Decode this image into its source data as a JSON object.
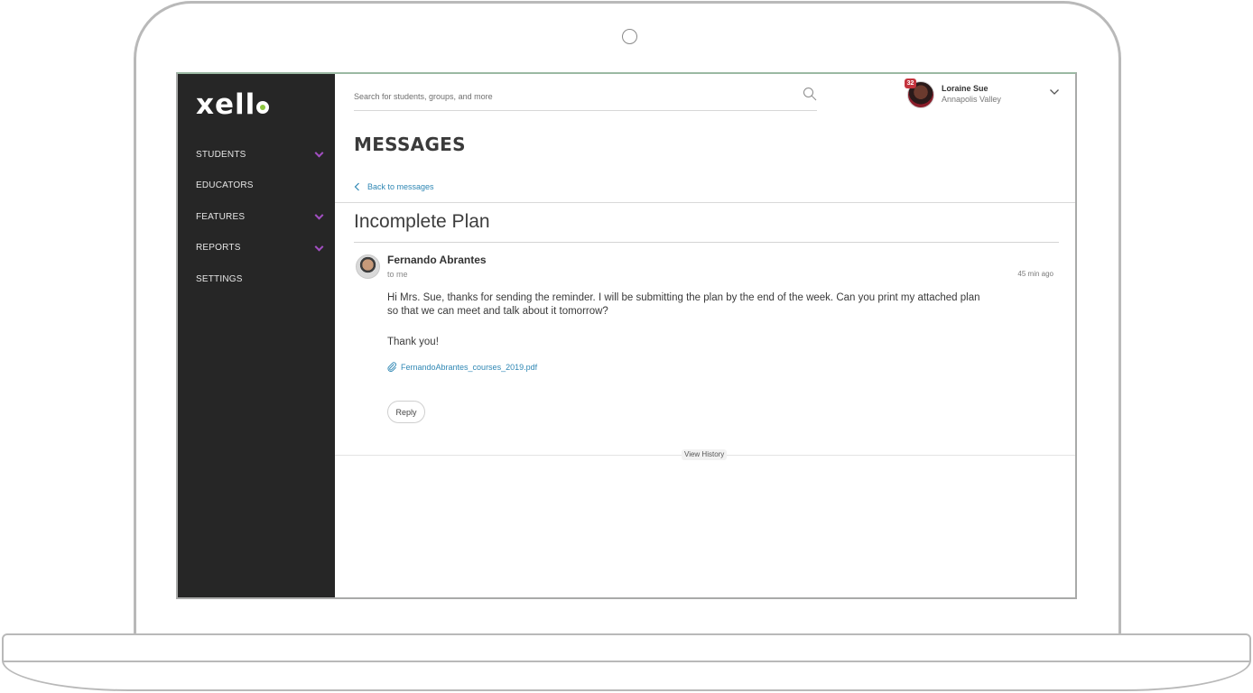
{
  "brand": {
    "logo_text": "xell",
    "logo_accent_color": "#8dc63f",
    "sidebar_color": "#262626",
    "chevron_color": "#a24fc2",
    "link_color": "#2f87b4"
  },
  "sidebar": {
    "items": [
      {
        "label": "STUDENTS",
        "has_chevron": true
      },
      {
        "label": "EDUCATORS",
        "has_chevron": false
      },
      {
        "label": "FEATURES",
        "has_chevron": true
      },
      {
        "label": "REPORTS",
        "has_chevron": true
      },
      {
        "label": "SETTINGS",
        "has_chevron": false
      }
    ]
  },
  "header": {
    "search_placeholder": "Search for students, groups, and more",
    "search_icon": "search-icon",
    "user": {
      "name": "Loraine Sue",
      "school": "Annapolis Valley",
      "notification_count": "32",
      "dropdown_icon": "chevron-down-icon"
    }
  },
  "page": {
    "title": "MESSAGES",
    "back_label": "Back to messages"
  },
  "message": {
    "subject": "Incomplete Plan",
    "sender": "Fernando Abrantes",
    "recipient": "to me",
    "time": "45 min ago",
    "body": "Hi Mrs. Sue, thanks for sending the reminder. I will be submitting the plan by the end of the week. Can you print my attached plan so that we can meet and talk about it tomorrow?",
    "closing": "Thank you!",
    "attachment": "FernandoAbrantes_courses_2019.pdf",
    "reply_label": "Reply",
    "history_label": "View History"
  }
}
